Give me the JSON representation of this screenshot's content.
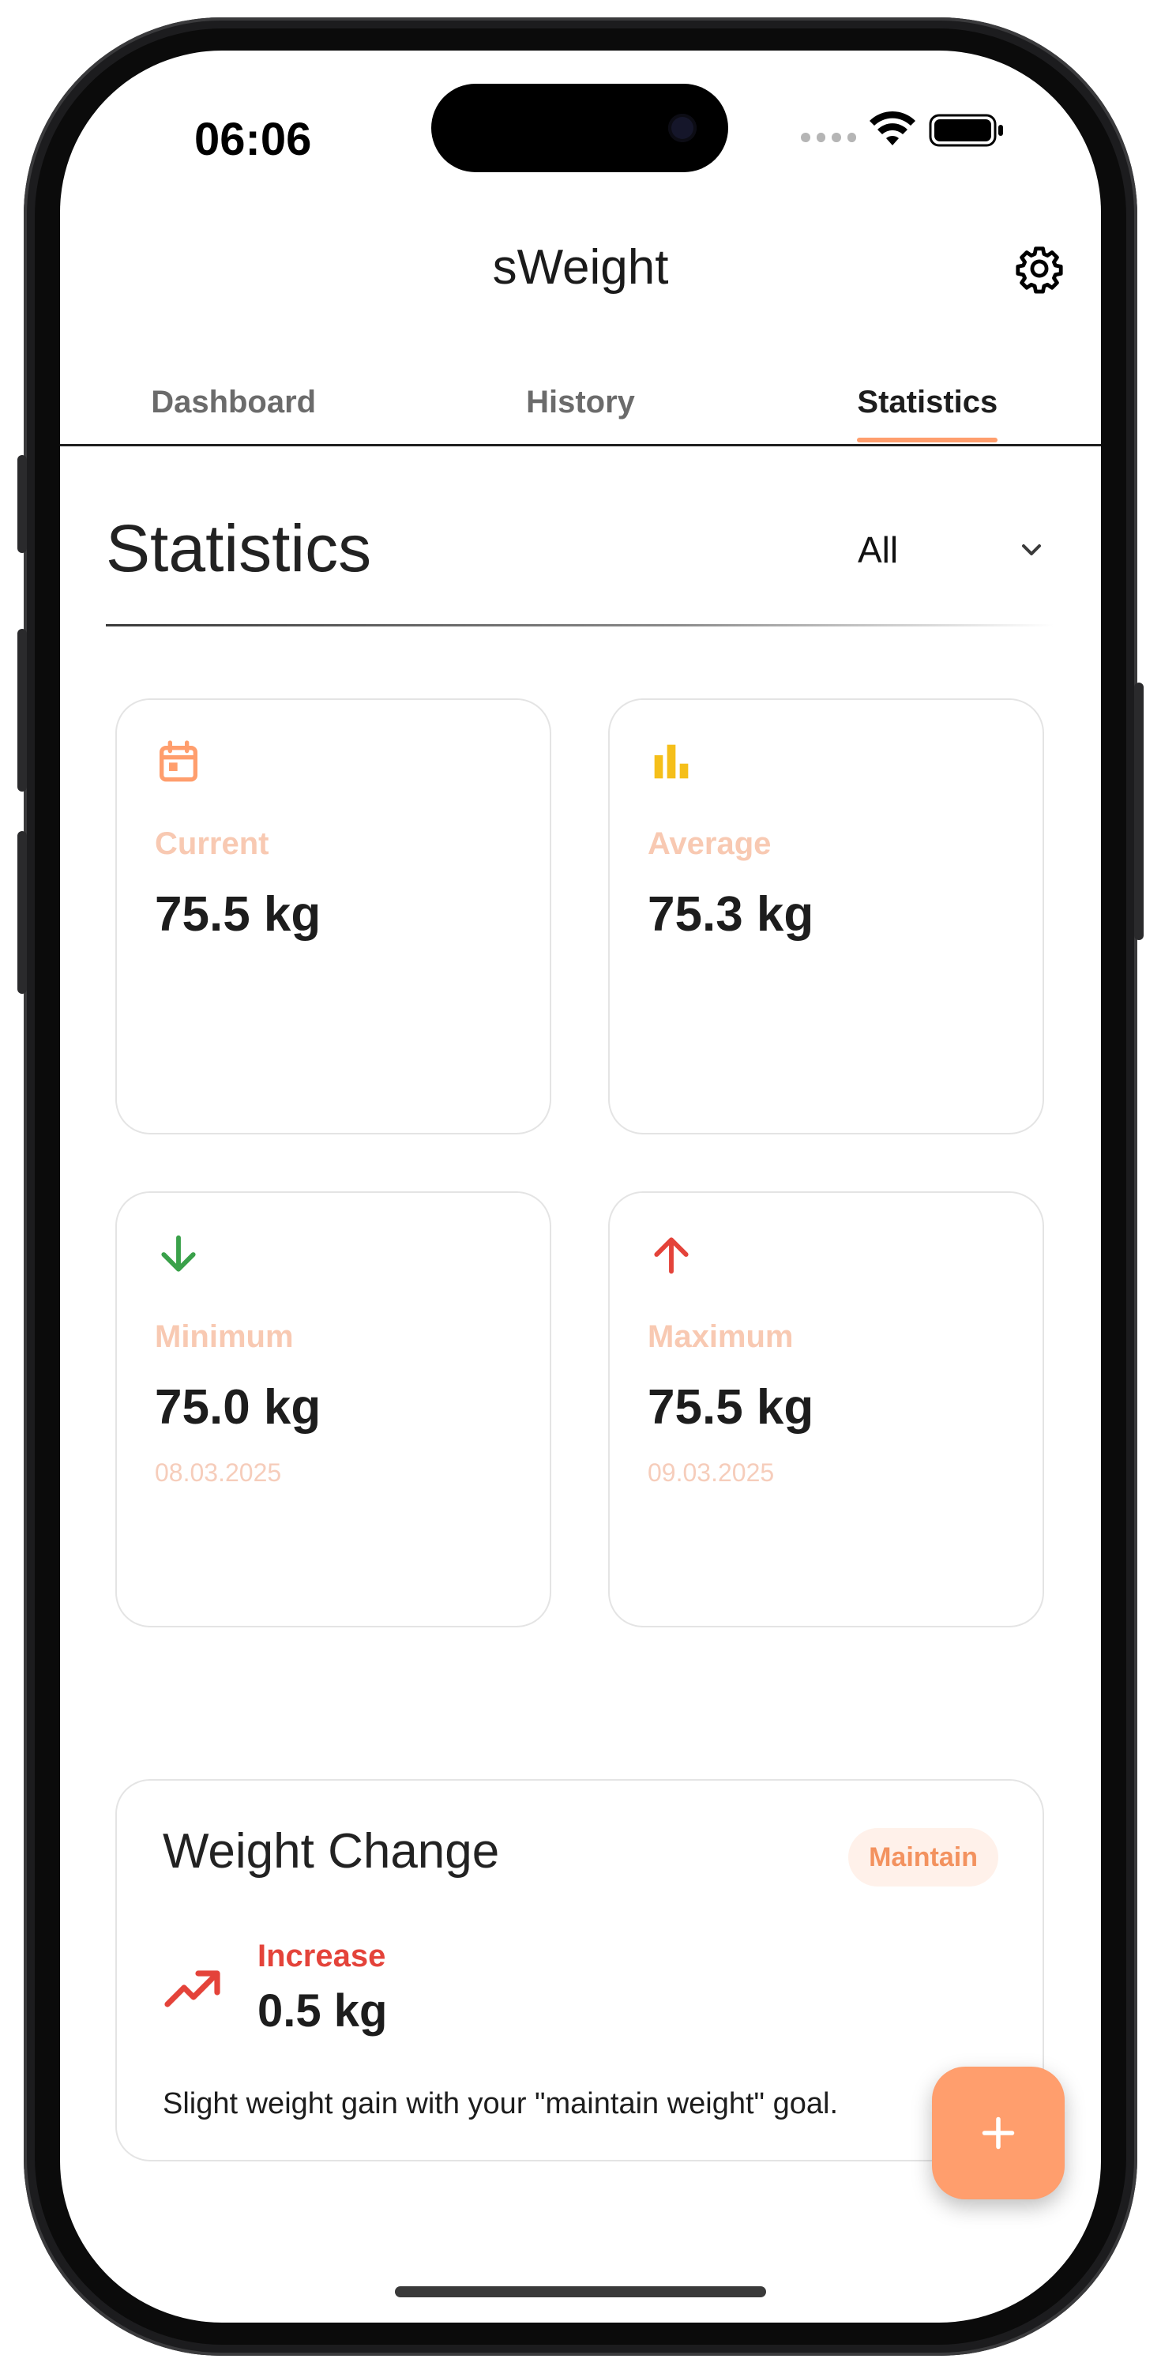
{
  "status_bar": {
    "time": "06:06"
  },
  "app": {
    "title": "sWeight"
  },
  "tabs": [
    {
      "label": "Dashboard",
      "active": false
    },
    {
      "label": "History",
      "active": false
    },
    {
      "label": "Statistics",
      "active": true
    }
  ],
  "section": {
    "title": "Statistics",
    "period_selected": "All"
  },
  "cards": [
    {
      "icon": "calendar-icon",
      "label": "Current",
      "value": "75.5 kg",
      "date": "",
      "icon_color": "#ff9e6d"
    },
    {
      "icon": "bar-chart-icon",
      "label": "Average",
      "value": "75.3 kg",
      "date": "",
      "icon_color": "#f5bf1a"
    },
    {
      "icon": "arrow-down-icon",
      "label": "Minimum",
      "value": "75.0 kg",
      "date": "08.03.2025",
      "icon_color": "#3aa14a"
    },
    {
      "icon": "arrow-up-icon",
      "label": "Maximum",
      "value": "75.5 kg",
      "date": "09.03.2025",
      "icon_color": "#e4433a"
    }
  ],
  "weight_change": {
    "title": "Weight Change",
    "goal_badge": "Maintain",
    "direction": "Increase",
    "amount": "0.5 kg",
    "description": "Slight weight gain with your \"maintain weight\" goal."
  },
  "colors": {
    "accent": "#ff9e6d",
    "increase": "#e4433a"
  }
}
